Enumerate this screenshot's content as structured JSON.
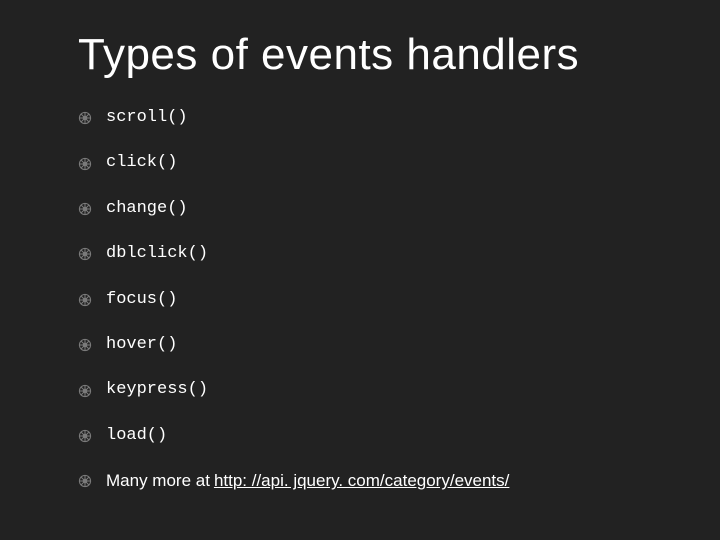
{
  "title": "Types of events handlers",
  "items": [
    {
      "text": "scroll()",
      "code": true
    },
    {
      "text": "click()",
      "code": true
    },
    {
      "text": "change()",
      "code": true
    },
    {
      "text": "dblclick()",
      "code": true
    },
    {
      "text": "focus()",
      "code": true
    },
    {
      "text": "hover()",
      "code": true
    },
    {
      "text": "keypress()",
      "code": true
    },
    {
      "text": "load()",
      "code": true
    }
  ],
  "more": {
    "prefix": "Many more at",
    "link_text": "http: //api. jquery. com/category/events/",
    "link_href": "http://api.jquery.com/category/events/"
  },
  "bullet_icon": "spoked-wheel-icon"
}
